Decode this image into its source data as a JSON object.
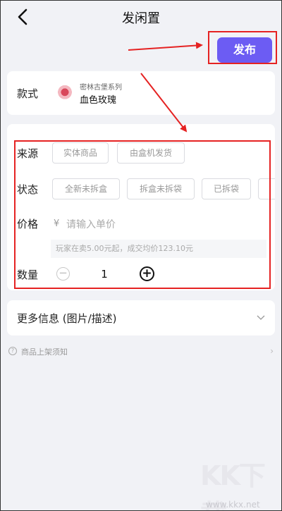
{
  "header": {
    "title": "发闲置",
    "publish_label": "发布"
  },
  "style_card": {
    "label": "款式",
    "series": "密林古堡系列",
    "name": "血色玫瑰"
  },
  "form": {
    "source": {
      "label": "来源",
      "options": [
        "实体商品",
        "由盒机发货"
      ]
    },
    "condition": {
      "label": "状态",
      "options": [
        "全新未拆盒",
        "拆盒未拆袋",
        "已拆袋"
      ]
    },
    "price": {
      "label": "价格",
      "currency": "¥",
      "placeholder": "请输入单价",
      "hint": "玩家在卖5.00元起，成交均价123.10元"
    },
    "quantity": {
      "label": "数量",
      "value": "1",
      "minus": "−",
      "plus": "+"
    }
  },
  "more_info": {
    "label": "更多信息 (图片/描述)"
  },
  "notice": {
    "icon_glyph": "?",
    "label": "商品上架须知",
    "chevron": "›"
  },
  "watermark": {
    "text": "KK下载",
    "url": "www.kkx.net"
  },
  "colors": {
    "accent": "#6c5cf3",
    "annotation": "#e52222",
    "background": "#f1f2f6"
  }
}
